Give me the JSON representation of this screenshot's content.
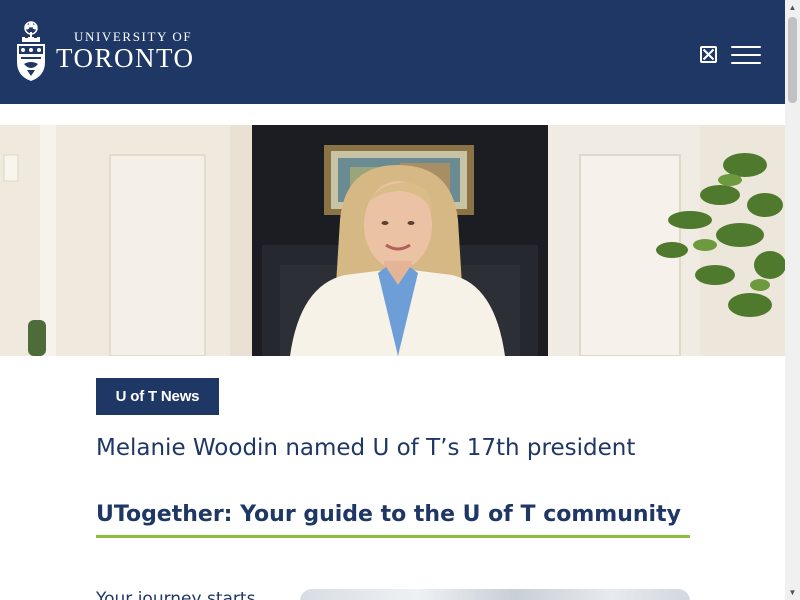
{
  "header": {
    "logo_line1": "UNIVERSITY OF",
    "logo_line2": "TORONTO",
    "bg_color": "#1e3765",
    "icons": [
      "crest-icon",
      "close-box-icon",
      "hamburger-menu-icon"
    ]
  },
  "hero": {
    "image": "portrait-photo"
  },
  "news": {
    "tag": "U of T News",
    "headline": "Melanie Woodin named U of T’s 17th president"
  },
  "section": {
    "title": "UTogether: Your guide to the U of T community",
    "accent_color": "#8dbf3c"
  },
  "card": {
    "text": "Your journey starts"
  }
}
